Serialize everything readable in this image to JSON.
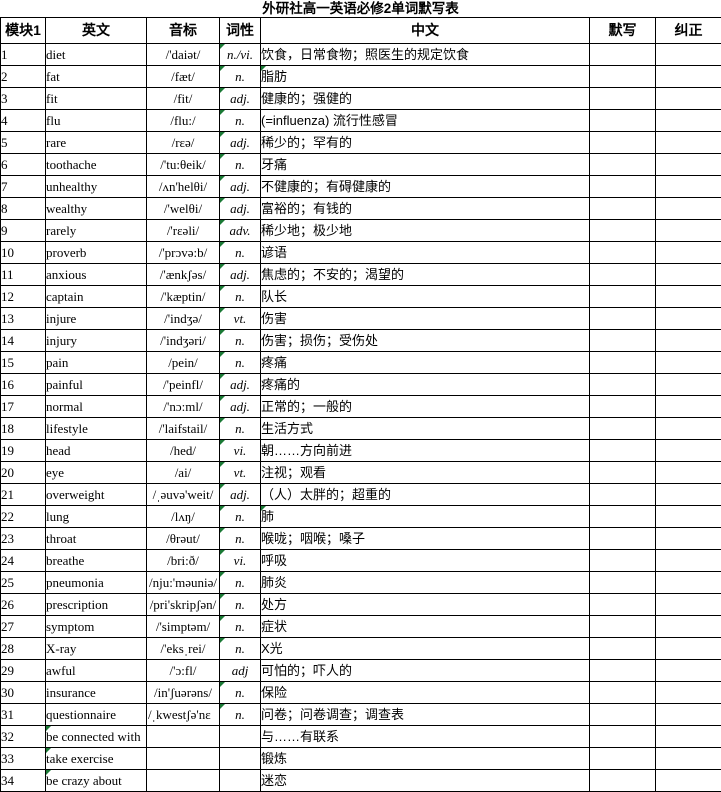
{
  "document": {
    "title": "外研社高一英语必修2单词默写表"
  },
  "table": {
    "headers": {
      "index": "模块1",
      "english": "英文",
      "phonetic": "音标",
      "pos": "词性",
      "chinese": "中文",
      "dictation": "默写",
      "correction": "纠正"
    },
    "rows": [
      {
        "no": "1",
        "english": "diet",
        "phonetic": "/'daiət/",
        "pos": "n./vi.",
        "chinese": "饮食，日常食物；照医生的规定饮食",
        "dictation": "",
        "correction": "",
        "comment_pos": true,
        "comment_eng": false,
        "comment_chn": false
      },
      {
        "no": "2",
        "english": "fat",
        "phonetic": "/fæt/",
        "pos": "n.",
        "chinese": "脂肪",
        "dictation": "",
        "correction": "",
        "comment_pos": true,
        "comment_eng": false,
        "comment_chn": true
      },
      {
        "no": "3",
        "english": "fit",
        "phonetic": "/fit/",
        "pos": "adj.",
        "chinese": "健康的；强健的",
        "dictation": "",
        "correction": "",
        "comment_pos": true,
        "comment_eng": false,
        "comment_chn": false
      },
      {
        "no": "4",
        "english": "flu",
        "phonetic": "/flu:/",
        "pos": "n.",
        "chinese": "(=influenza) 流行性感冒",
        "dictation": "",
        "correction": "",
        "comment_pos": true,
        "comment_eng": false,
        "comment_chn": false
      },
      {
        "no": "5",
        "english": "rare",
        "phonetic": "/rɛə/",
        "pos": "adj.",
        "chinese": "稀少的；罕有的",
        "dictation": "",
        "correction": "",
        "comment_pos": true,
        "comment_eng": false,
        "comment_chn": false
      },
      {
        "no": "6",
        "english": "toothache",
        "phonetic": "/'tu:θeik/",
        "pos": "n.",
        "chinese": "牙痛",
        "dictation": "",
        "correction": "",
        "comment_pos": true,
        "comment_eng": false,
        "comment_chn": false
      },
      {
        "no": "7",
        "english": "unhealthy",
        "phonetic": "/ʌn'helθi/",
        "pos": "adj.",
        "chinese": "不健康的；有碍健康的",
        "dictation": "",
        "correction": "",
        "comment_pos": true,
        "comment_eng": false,
        "comment_chn": false
      },
      {
        "no": "8",
        "english": "wealthy",
        "phonetic": "/'welθi/",
        "pos": "adj.",
        "chinese": "富裕的；有钱的",
        "dictation": "",
        "correction": "",
        "comment_pos": true,
        "comment_eng": false,
        "comment_chn": false
      },
      {
        "no": "9",
        "english": "rarely",
        "phonetic": "/'rɛəli/",
        "pos": "adv.",
        "chinese": "稀少地；极少地",
        "dictation": "",
        "correction": "",
        "comment_pos": true,
        "comment_eng": false,
        "comment_chn": false
      },
      {
        "no": "10",
        "english": "proverb",
        "phonetic": "/'prɔvə:b/",
        "pos": "n.",
        "chinese": "谚语",
        "dictation": "",
        "correction": "",
        "comment_pos": true,
        "comment_eng": false,
        "comment_chn": false
      },
      {
        "no": "11",
        "english": "anxious",
        "phonetic": "/'ænkʃəs/",
        "pos": "adj.",
        "chinese": "焦虑的；不安的；渴望的",
        "dictation": "",
        "correction": "",
        "comment_pos": true,
        "comment_eng": false,
        "comment_chn": false
      },
      {
        "no": "12",
        "english": "captain",
        "phonetic": "/'kæptin/",
        "pos": "n.",
        "chinese": "队长",
        "dictation": "",
        "correction": "",
        "comment_pos": true,
        "comment_eng": false,
        "comment_chn": false
      },
      {
        "no": "13",
        "english": "injure",
        "phonetic": "/'indʒə/",
        "pos": "vt.",
        "chinese": "伤害",
        "dictation": "",
        "correction": "",
        "comment_pos": true,
        "comment_eng": false,
        "comment_chn": false
      },
      {
        "no": "14",
        "english": "injury",
        "phonetic": "/'indʒəri/",
        "pos": "n.",
        "chinese": "伤害；损伤；受伤处",
        "dictation": "",
        "correction": "",
        "comment_pos": true,
        "comment_eng": false,
        "comment_chn": false
      },
      {
        "no": "15",
        "english": "pain",
        "phonetic": "/pein/",
        "pos": "n.",
        "chinese": "疼痛",
        "dictation": "",
        "correction": "",
        "comment_pos": true,
        "comment_eng": false,
        "comment_chn": false
      },
      {
        "no": "16",
        "english": "painful",
        "phonetic": "/'peinfl/",
        "pos": "adj.",
        "chinese": "疼痛的",
        "dictation": "",
        "correction": "",
        "comment_pos": true,
        "comment_eng": false,
        "comment_chn": false
      },
      {
        "no": "17",
        "english": "normal",
        "phonetic": "/'nɔ:ml/",
        "pos": "adj.",
        "chinese": "正常的；一般的",
        "dictation": "",
        "correction": "",
        "comment_pos": true,
        "comment_eng": false,
        "comment_chn": false
      },
      {
        "no": "18",
        "english": "lifestyle",
        "phonetic": "/'laifstail/",
        "pos": "n.",
        "chinese": "生活方式",
        "dictation": "",
        "correction": "",
        "comment_pos": true,
        "comment_eng": false,
        "comment_chn": false
      },
      {
        "no": "19",
        "english": "head",
        "phonetic": "/hed/",
        "pos": "vi.",
        "chinese": "朝……方向前进",
        "dictation": "",
        "correction": "",
        "comment_pos": true,
        "comment_eng": false,
        "comment_chn": false
      },
      {
        "no": "20",
        "english": "eye",
        "phonetic": "/ai/",
        "pos": "vt.",
        "chinese": "注视；观看",
        "dictation": "",
        "correction": "",
        "comment_pos": true,
        "comment_eng": false,
        "comment_chn": false
      },
      {
        "no": "21",
        "english": "overweight",
        "phonetic": "/ˌəuvə'weit/",
        "pos": "adj.",
        "chinese": "（人）太胖的；超重的",
        "dictation": "",
        "correction": "",
        "comment_pos": true,
        "comment_eng": false,
        "comment_chn": false
      },
      {
        "no": "22",
        "english": "lung",
        "phonetic": "/lʌŋ/",
        "pos": "n.",
        "chinese": "肺",
        "dictation": "",
        "correction": "",
        "comment_pos": true,
        "comment_eng": false,
        "comment_chn": true
      },
      {
        "no": "23",
        "english": "throat",
        "phonetic": "/θrəut/",
        "pos": "n.",
        "chinese": "喉咙；咽喉；嗓子",
        "dictation": "",
        "correction": "",
        "comment_pos": true,
        "comment_eng": false,
        "comment_chn": false
      },
      {
        "no": "24",
        "english": "breathe",
        "phonetic": "/bri:ð/",
        "pos": "vi.",
        "chinese": "呼吸",
        "dictation": "",
        "correction": "",
        "comment_pos": true,
        "comment_eng": false,
        "comment_chn": false
      },
      {
        "no": "25",
        "english": "pneumonia",
        "phonetic": "/nju:'məuniə/",
        "pos": "n.",
        "chinese": "肺炎",
        "dictation": "",
        "correction": "",
        "comment_pos": true,
        "comment_eng": false,
        "comment_chn": false
      },
      {
        "no": "26",
        "english": "prescription",
        "phonetic": "/pri'skripʃən/",
        "pos": "n.",
        "chinese": "处方",
        "dictation": "",
        "correction": "",
        "comment_pos": true,
        "comment_eng": false,
        "comment_chn": false
      },
      {
        "no": "27",
        "english": "symptom",
        "phonetic": "/'simptəm/",
        "pos": "n.",
        "chinese": "症状",
        "dictation": "",
        "correction": "",
        "comment_pos": true,
        "comment_eng": false,
        "comment_chn": false
      },
      {
        "no": "28",
        "english": "X-ray",
        "phonetic": "/'eksˌrei/",
        "pos": "n.",
        "chinese": "X光",
        "dictation": "",
        "correction": "",
        "comment_pos": true,
        "comment_eng": false,
        "comment_chn": false
      },
      {
        "no": "29",
        "english": "awful",
        "phonetic": "/'ɔ:fl/",
        "pos": "adj",
        "chinese": "可怕的；吓人的",
        "dictation": "",
        "correction": "",
        "comment_pos": false,
        "comment_eng": false,
        "comment_chn": false
      },
      {
        "no": "30",
        "english": "insurance",
        "phonetic": "/in'ʃuərəns/",
        "pos": "n.",
        "chinese": "保险",
        "dictation": "",
        "correction": "",
        "comment_pos": true,
        "comment_eng": false,
        "comment_chn": false
      },
      {
        "no": "31",
        "english": "questionnaire",
        "phonetic": "/ˌkwestʃə'nɛ",
        "pos": "n.",
        "chinese": "问卷；问卷调查；调查表",
        "dictation": "",
        "correction": "",
        "comment_pos": true,
        "comment_eng": false,
        "comment_chn": false,
        "phonetic_overflow": true
      },
      {
        "no": "32",
        "english": "be connected with",
        "phonetic": "",
        "pos": "",
        "chinese": "与……有联系",
        "dictation": "",
        "correction": "",
        "comment_pos": false,
        "comment_eng": true,
        "comment_chn": false
      },
      {
        "no": "33",
        "english": "take exercise",
        "phonetic": "",
        "pos": "",
        "chinese": "锻炼",
        "dictation": "",
        "correction": "",
        "comment_pos": false,
        "comment_eng": true,
        "comment_chn": false
      },
      {
        "no": "34",
        "english": "be crazy about",
        "phonetic": "",
        "pos": "",
        "chinese": "迷恋",
        "dictation": "",
        "correction": "",
        "comment_pos": false,
        "comment_eng": true,
        "comment_chn": false
      }
    ]
  },
  "colors": {
    "grid_line": "#000000",
    "comment_marker": "#1a7a35",
    "background": "#ffffff",
    "text": "#000000"
  }
}
